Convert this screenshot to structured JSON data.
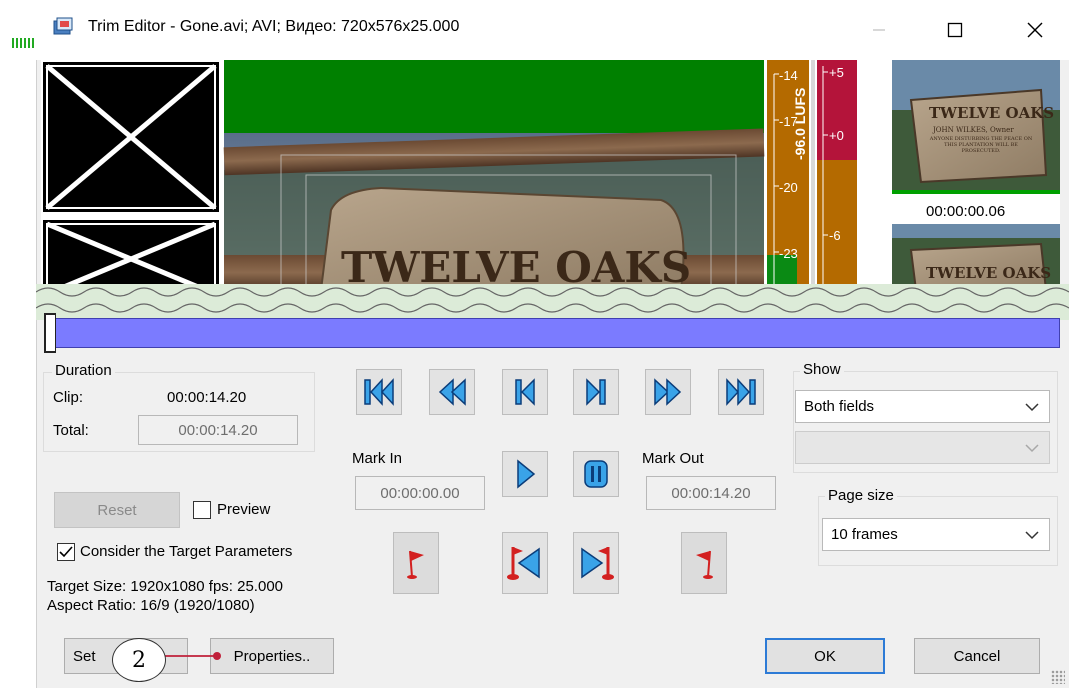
{
  "window": {
    "title": "Trim Editor - Gone.avi; AVI; Видео: 720x576x25.000",
    "minimize_icon": "minimize-icon",
    "maximize_icon": "maximize-icon",
    "close_icon": "close-icon"
  },
  "preview": {
    "meter_left_ticks": [
      "-14",
      "-17",
      "-20",
      "-23"
    ],
    "lufs_label": "-96.0 LUFS",
    "meter_right_ticks": [
      "+5",
      "+0",
      "-6"
    ],
    "sign_text": "TWELVE OAKS",
    "thumb_sign_title": "TWELVE OAKS",
    "thumb_sign_sub": "JOHN WILKES, Owner",
    "thumb_sign_notice": "ANYONE DISTURBING THE PEACE ON THIS PLANTATION WILL BE PROSECUTED.",
    "thumb2_sign_title": "TWELVE OAKS",
    "thumb_time": "00:00:00.06"
  },
  "duration": {
    "group_label": "Duration",
    "clip_label": "Clip:",
    "clip_value": "00:00:14.20",
    "total_label": "Total:",
    "total_value": "00:00:14.20"
  },
  "transport": {
    "icons": [
      "go-to-start-icon",
      "rewind-icon",
      "step-back-icon",
      "step-forward-icon",
      "fast-forward-icon",
      "go-to-end-icon"
    ]
  },
  "marks": {
    "mark_in_label": "Mark In",
    "mark_in_value": "00:00:00.00",
    "mark_out_label": "Mark Out",
    "mark_out_value": "00:00:14.20"
  },
  "controls": {
    "reset_label": "Reset",
    "preview_label": "Preview",
    "consider_label": "Consider the Target Parameters",
    "consider_checked": true,
    "target_size": "Target Size: 1920x1080 fps: 25.000",
    "aspect_ratio": "Aspect Ratio: 16/9 (1920/1080)"
  },
  "show": {
    "group_label": "Show",
    "selected": "Both fields",
    "second_selected": ""
  },
  "page_size": {
    "group_label": "Page size",
    "selected": "10 frames"
  },
  "buttons": {
    "settings_label": "Set",
    "settings_suffix": "..",
    "properties_label": "Properties..",
    "ok_label": "OK",
    "cancel_label": "Cancel"
  },
  "callout": {
    "number": "2"
  },
  "colors": {
    "timeline": "#7b7bff",
    "transport_blue": "#3aa3e8",
    "flag_red": "#d32020",
    "meter_orange": "#b46a00",
    "meter_red": "#b4143a",
    "meter_green": "#0a8a14",
    "default_button_border": "#2d7bd6"
  }
}
